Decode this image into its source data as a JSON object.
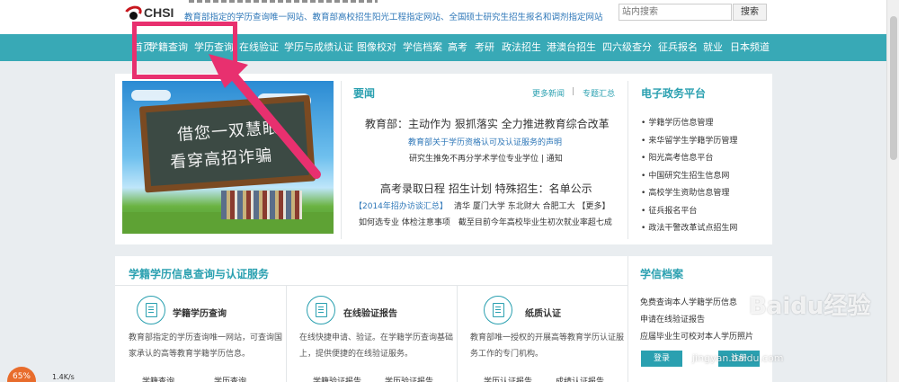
{
  "header": {
    "logo_text": "CHSI",
    "tagline": "教育部指定的学历查询唯一网站、教育部高校招生阳光工程指定网站、全国硕士研究生招生报名和调剂指定网站",
    "search_placeholder": "站内搜索",
    "search_button": "搜索"
  },
  "nav": {
    "items": [
      "首页",
      "学籍查询",
      "学历查询",
      "在线验证",
      "学历与成绩认证",
      "图像校对",
      "学信档案",
      "高考",
      "考研",
      "政法招生",
      "港澳台招生",
      "四六级查分",
      "征兵报名",
      "就业",
      "日本频道"
    ]
  },
  "banner": {
    "line1": "借您一双慧眼",
    "line2": "看穿高招诈骗"
  },
  "news": {
    "title": "要闻",
    "more": "更多新闻",
    "separator": "|",
    "topics": "专题汇总",
    "headline1": "教育部：主动作为 狠抓落实 全力推进教育综合改革",
    "link1": "教育部关于学历资格认可及认证服务的声明",
    "line1b": "研究生推免不再分学术学位专业学位 | 通知",
    "headline2": "高考录取日程 招生计划 特殊招生：名单公示",
    "line2a_blue": "【2014年招办访谈汇总】",
    "line2a_rest": "清华 厦门大学 东北财大 合肥工大 【更多】",
    "line2b": "如何选专业 体检注意事项　截至目前今年高校毕业生初次就业率超七成"
  },
  "gov": {
    "title": "电子政务平台",
    "items": [
      "学籍学历信息管理",
      "来华留学生学籍学历管理",
      "阳光高考信息平台",
      "中国研究生招生信息网",
      "高校学生资助信息管理",
      "征兵报名平台",
      "政法干警改革试点招生网"
    ]
  },
  "services": {
    "title": "学籍学历信息查询与认证服务",
    "cards": [
      {
        "name": "学籍学历查询",
        "desc": "教育部指定的学历查询唯一网站，可查询国家承认的高等教育学籍学历信息。",
        "cut_left": "学籍查询",
        "cut_right": "学历查询"
      },
      {
        "name": "在线验证报告",
        "desc": "在线快捷申请、验证。在学籍学历查询基础上，提供便捷的在线验证服务。",
        "cut_left": "学籍验证报告",
        "cut_right": "学历验证报告"
      },
      {
        "name": "纸质认证",
        "desc": "教育部唯一授权的开展高等教育学历认证服务工作的专门机构。",
        "cut_left": "学历认证报告",
        "cut_right": "成绩认证报告"
      }
    ]
  },
  "archive": {
    "title": "学信档案",
    "lines": [
      "免费查询本人学籍学历信息",
      "申请在线验证报告",
      "应届毕业生可校对本人学历照片"
    ],
    "login": "登录",
    "register": "注册"
  },
  "watermark": {
    "brand": "Baidu经验",
    "url": "jingyan.baidu.com"
  },
  "widget": {
    "percent": "65%",
    "speed": "1.4K/s"
  },
  "colors": {
    "nav_bg": "#38a9b6",
    "accent": "#2aa0b0",
    "highlight": "#e8306f"
  }
}
